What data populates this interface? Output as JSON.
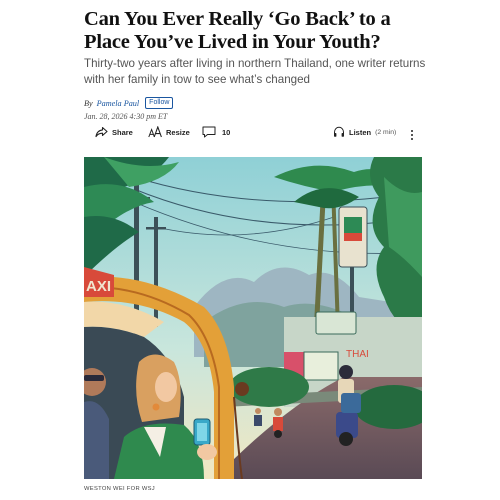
{
  "article": {
    "headline": "Can You Ever Really ‘Go Back’ to a Place You’ve Lived in Your Youth?",
    "dek": "Thirty-two years after living in northern Thailand, one writer returns with her family in tow to see what’s changed",
    "byline_prefix": "By",
    "author": "Pamela Paul",
    "follow_label": "Follow",
    "timestamp": "Jan. 28, 2026 4:30 pm ET"
  },
  "toolbar": {
    "share_label": "Share",
    "resize_label": "Resize",
    "comments_count": "10",
    "listen_label": "Listen",
    "listen_duration": "(2 min)"
  },
  "illustration": {
    "taxi_sign": "AXI",
    "shop_sign": "THAI",
    "credit": "WESTON WEI FOR WSJ"
  },
  "icons": {
    "share": "share-arrow-icon",
    "resize": "text-resize-icon",
    "comments": "comment-bubble-icon",
    "listen": "headphones-icon",
    "more": "more-vertical-icon"
  },
  "colors": {
    "author_link": "#1a56a0",
    "headline": "#111111",
    "dek": "#555555"
  }
}
